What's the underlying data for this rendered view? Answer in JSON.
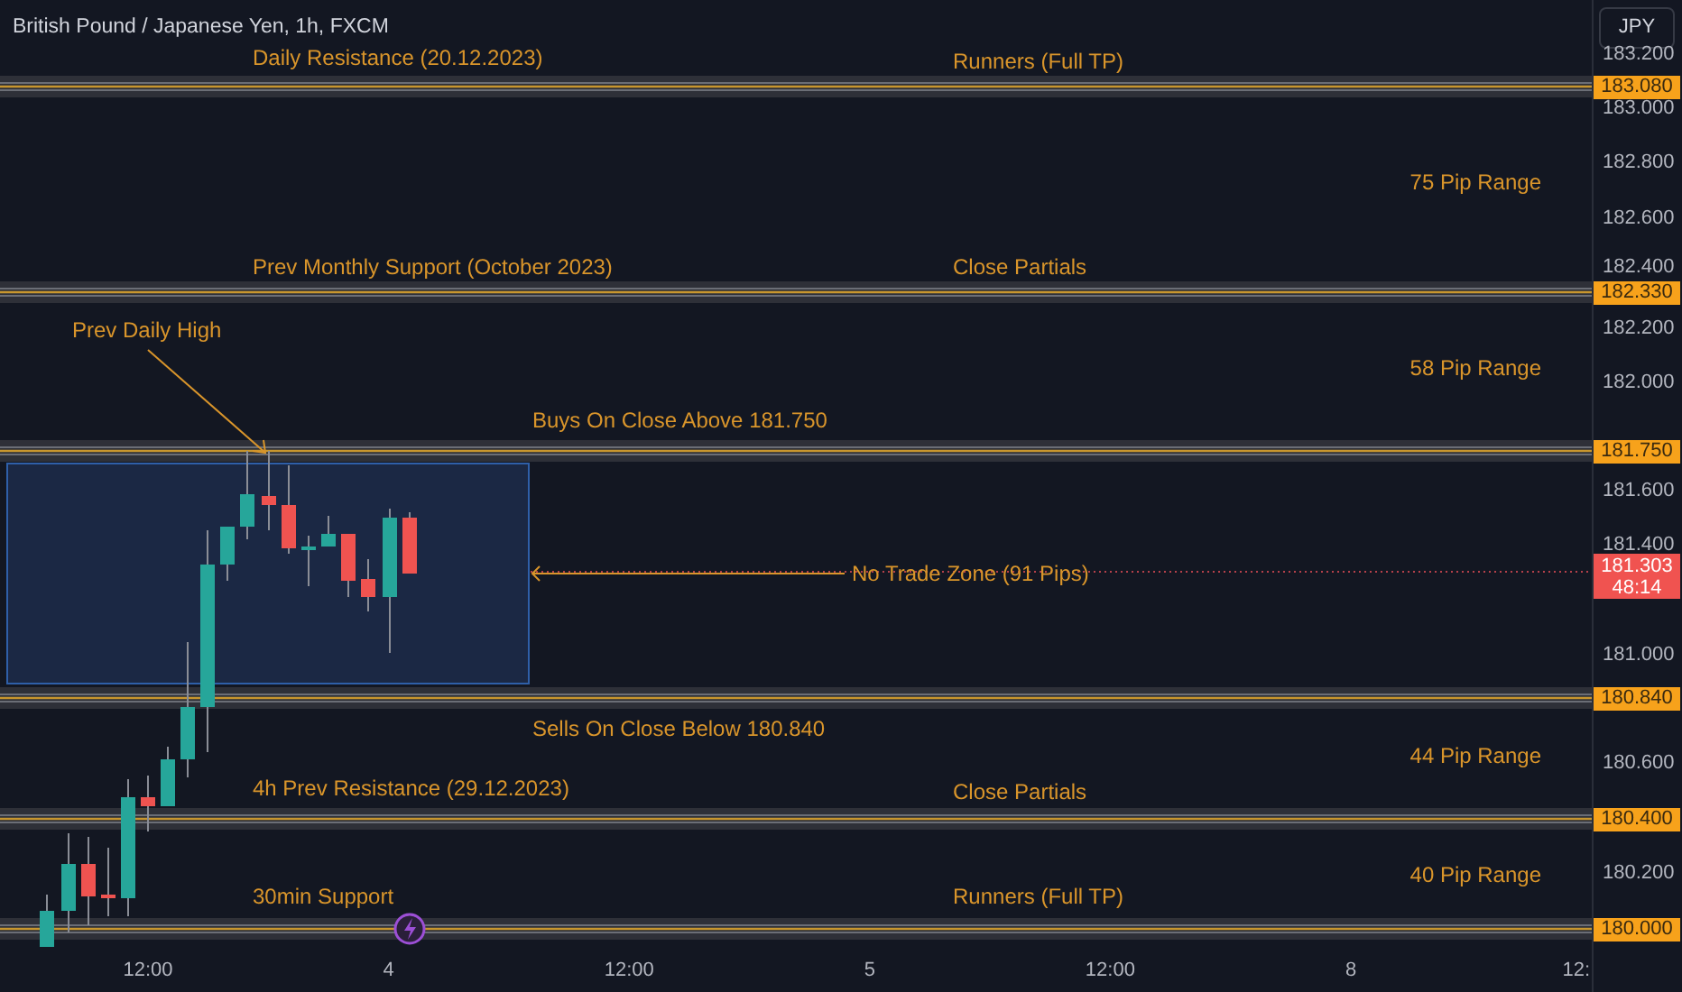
{
  "title": "British Pound / Japanese Yen, 1h, FXCM",
  "currency_button": "JPY",
  "price_axis": [
    "183.200",
    "183.000",
    "182.800",
    "182.600",
    "182.400",
    "182.200",
    "182.000",
    "181.600",
    "181.400",
    "181.000",
    "180.600",
    "180.200"
  ],
  "levels": [
    {
      "price": "183.080",
      "labels": [
        "Daily Resistance (20.12.2023)",
        "Runners (Full TP)"
      ]
    },
    {
      "price": "182.330",
      "labels": [
        "Prev Monthly Support (October 2023)",
        "Close Partials"
      ]
    },
    {
      "price": "181.750",
      "labels": [
        "Buys On Close Above 181.750"
      ]
    },
    {
      "price": "180.840",
      "labels": [
        "Sells On Close Below 180.840"
      ]
    },
    {
      "price": "180.400",
      "labels": [
        "4h Prev Resistance (29.12.2023)",
        "Close Partials"
      ]
    },
    {
      "price": "180.000",
      "labels": [
        "30min Support",
        "Runners (Full TP)"
      ]
    }
  ],
  "range_labels": [
    "75 Pip Range",
    "58 Pip Range",
    "44 Pip Range",
    "40 Pip Range"
  ],
  "annotation": "Prev Daily High",
  "zone": {
    "label": "No Trade Zone (91 Pips)"
  },
  "current_price": {
    "price": "181.303",
    "countdown": "48:14"
  },
  "time_axis": [
    "12:00",
    "4",
    "12:00",
    "5",
    "12:00",
    "8",
    "12:"
  ]
}
